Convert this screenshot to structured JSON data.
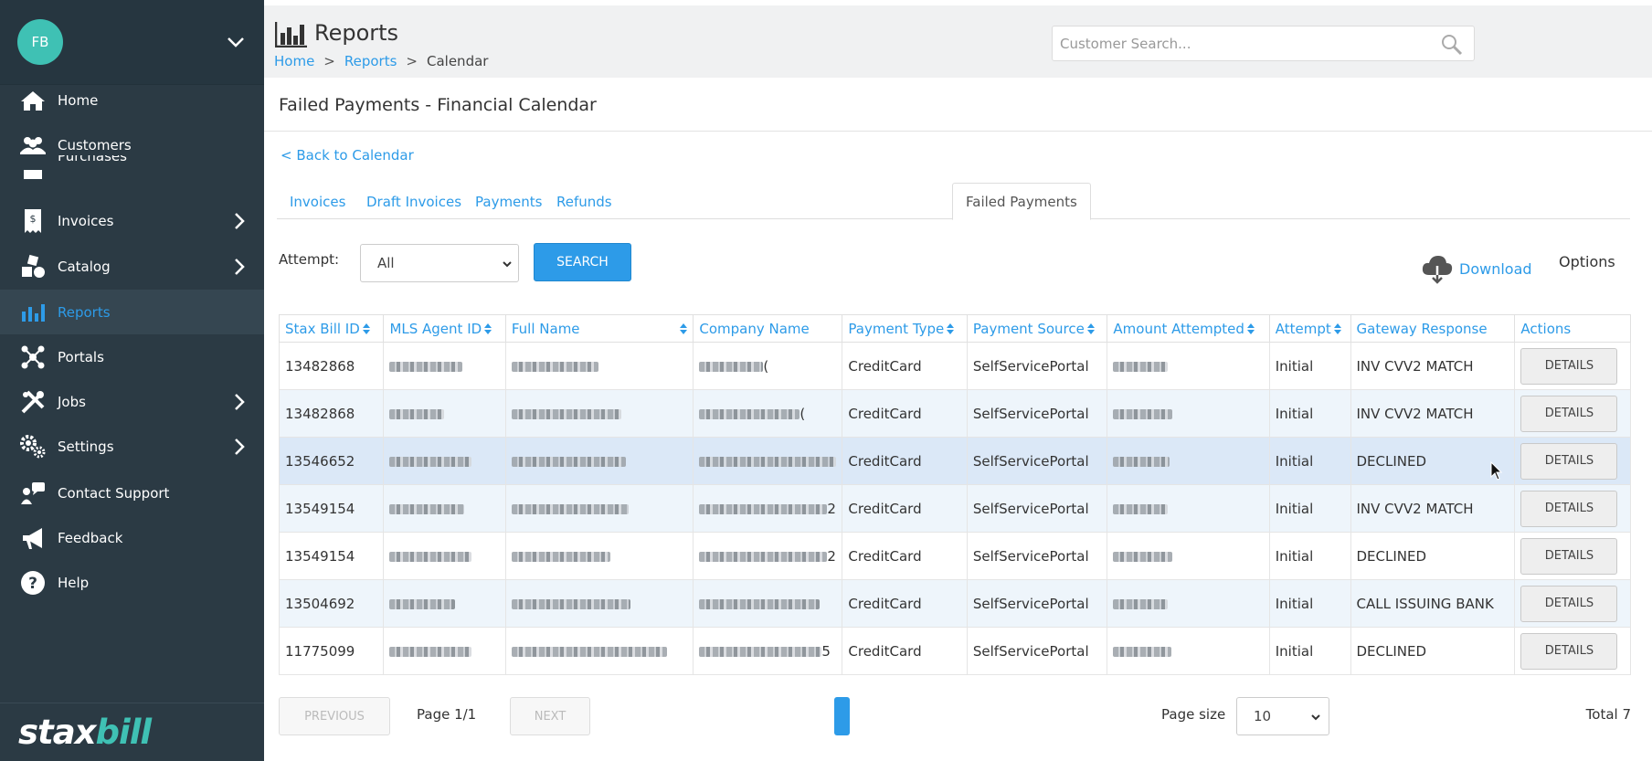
{
  "sidebar": {
    "avatar_initials": "FB",
    "items": [
      {
        "label": "Home",
        "icon": "home-icon"
      },
      {
        "label": "Customers",
        "icon": "users-icon"
      },
      {
        "label": "Purchases",
        "icon": "purchases-icon"
      },
      {
        "label": "Invoices",
        "icon": "invoice-icon"
      },
      {
        "label": "Catalog",
        "icon": "catalog-icon"
      },
      {
        "label": "Reports",
        "icon": "bar-chart-icon"
      },
      {
        "label": "Portals",
        "icon": "portals-icon"
      },
      {
        "label": "Jobs",
        "icon": "tools-icon"
      },
      {
        "label": "Settings",
        "icon": "gears-icon"
      },
      {
        "label": "Contact Support",
        "icon": "support-icon"
      },
      {
        "label": "Feedback",
        "icon": "megaphone-icon"
      },
      {
        "label": "Help",
        "icon": "help-icon"
      }
    ],
    "logo": {
      "part1": "stax",
      "part2": "bill"
    }
  },
  "header": {
    "title": "Reports",
    "breadcrumb": [
      "Home",
      "Reports",
      "Calendar"
    ],
    "search_placeholder": "Customer Search..."
  },
  "page": {
    "title": "Failed Payments - Financial Calendar",
    "back_link": "< Back to Calendar",
    "tabs": [
      "Invoices",
      "Draft Invoices",
      "Payments",
      "Refunds",
      "Failed Payments"
    ],
    "active_tab": "Failed Payments",
    "filter": {
      "label": "Attempt:",
      "value": "All",
      "search_button": "SEARCH"
    },
    "download_label": "Download",
    "options_label": "Options"
  },
  "table": {
    "columns": [
      "Stax Bill ID",
      "MLS Agent ID",
      "Full Name",
      "Company Name",
      "Payment Type",
      "Payment Source",
      "Amount Attempted",
      "Attempt",
      "Gateway Response",
      "Actions"
    ],
    "action_label": "DETAILS",
    "rows": [
      {
        "id": "13482868",
        "payment_type": "CreditCard",
        "payment_source": "SelfServicePortal",
        "attempt": "Initial",
        "gateway_response": "INV CVV2 MATCH",
        "company_suffix": "("
      },
      {
        "id": "13482868",
        "payment_type": "CreditCard",
        "payment_source": "SelfServicePortal",
        "attempt": "Initial",
        "gateway_response": "INV CVV2 MATCH",
        "company_suffix": "("
      },
      {
        "id": "13546652",
        "payment_type": "CreditCard",
        "payment_source": "SelfServicePortal",
        "attempt": "Initial",
        "gateway_response": "DECLINED",
        "company_suffix": ""
      },
      {
        "id": "13549154",
        "payment_type": "CreditCard",
        "payment_source": "SelfServicePortal",
        "attempt": "Initial",
        "gateway_response": "INV CVV2 MATCH",
        "company_suffix": "2"
      },
      {
        "id": "13549154",
        "payment_type": "CreditCard",
        "payment_source": "SelfServicePortal",
        "attempt": "Initial",
        "gateway_response": "DECLINED",
        "company_suffix": "2"
      },
      {
        "id": "13504692",
        "payment_type": "CreditCard",
        "payment_source": "SelfServicePortal",
        "attempt": "Initial",
        "gateway_response": "CALL ISSUING BANK",
        "company_suffix": ""
      },
      {
        "id": "11775099",
        "payment_type": "CreditCard",
        "payment_source": "SelfServicePortal",
        "attempt": "Initial",
        "gateway_response": "DECLINED",
        "company_suffix": "5"
      }
    ]
  },
  "pagination": {
    "previous": "PREVIOUS",
    "next": "NEXT",
    "page_label": "Page 1/1",
    "page_size_label": "Page size",
    "page_size": "10",
    "total": "Total 7"
  },
  "colors": {
    "accent": "#2d9be8",
    "sidebar": "#2b3a44",
    "brand_teal": "#3fc1b4"
  }
}
